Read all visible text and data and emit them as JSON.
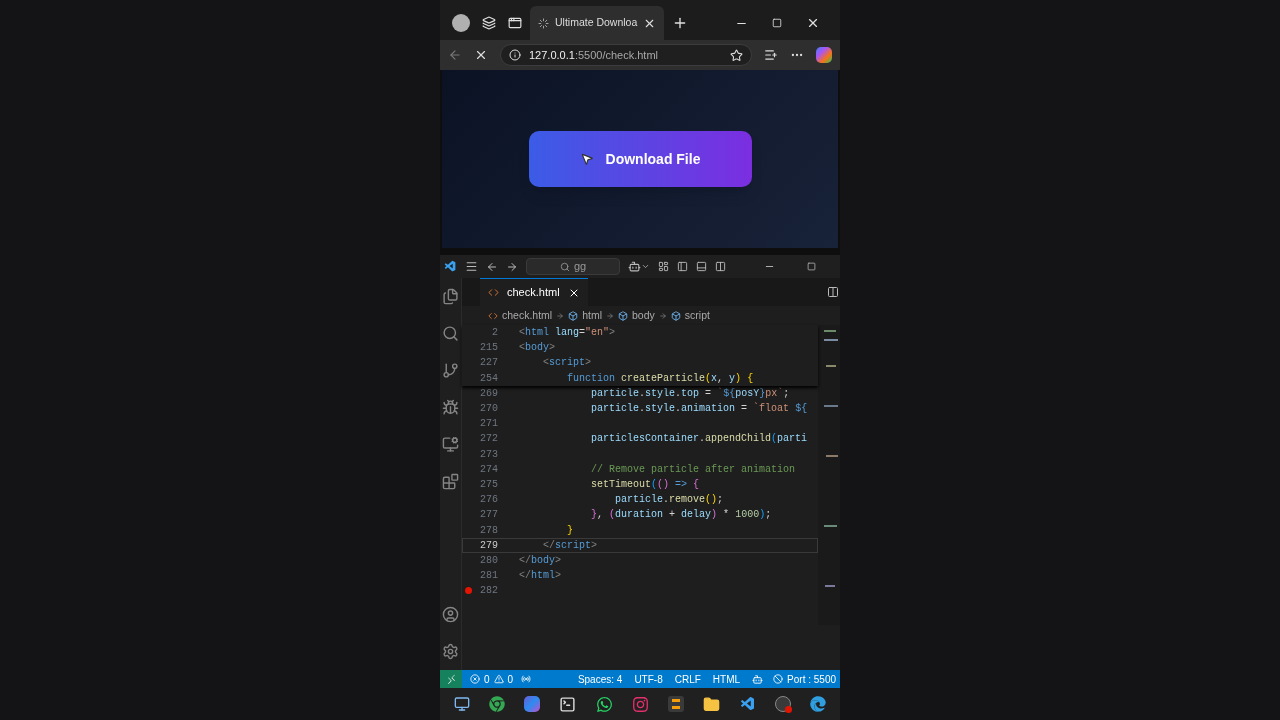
{
  "browser": {
    "tab": {
      "title": "Ultimate Downloa",
      "selected": true,
      "loading": true
    },
    "url_host": "127.0.0.1",
    "url_path": ":5500/check.html",
    "page_button": "Download File"
  },
  "editor": {
    "search": "gg",
    "tab": {
      "label": "check.html",
      "selected": true
    },
    "breadcrumbs": [
      "check.html",
      "html",
      "body",
      "script"
    ],
    "sticky_lines": [
      {
        "number": "2",
        "tokens": [
          {
            "text": "<",
            "kind": "punct"
          },
          {
            "text": "html",
            "kind": "tag"
          },
          {
            "text": " lang",
            "kind": "attr"
          },
          {
            "text": "=",
            "kind": "plain"
          },
          {
            "text": "\"en\"",
            "kind": "str"
          },
          {
            "text": ">",
            "kind": "punct"
          }
        ]
      },
      {
        "number": "215",
        "tokens": [
          {
            "text": "<",
            "kind": "punct"
          },
          {
            "text": "body",
            "kind": "tag"
          },
          {
            "text": ">",
            "kind": "punct"
          }
        ]
      },
      {
        "number": "227",
        "tokens": [
          {
            "text": "    <",
            "kind": "punct"
          },
          {
            "text": "script",
            "kind": "tag"
          },
          {
            "text": ">",
            "kind": "punct"
          }
        ]
      },
      {
        "number": "254",
        "tokens": [
          {
            "text": "        function ",
            "kind": "kw"
          },
          {
            "text": "createParticle",
            "kind": "fn"
          },
          {
            "text": "(",
            "kind": "br1"
          },
          {
            "text": "x",
            "kind": "var"
          },
          {
            "text": ", ",
            "kind": "plain"
          },
          {
            "text": "y",
            "kind": "var"
          },
          {
            "text": ")",
            "kind": "br1"
          },
          {
            "text": " {",
            "kind": "br1"
          }
        ]
      }
    ],
    "lines": [
      {
        "number": "269",
        "current": false,
        "breakpoint": false,
        "tokens": [
          {
            "text": "            particle",
            "kind": "var"
          },
          {
            "text": ".",
            "kind": "plain"
          },
          {
            "text": "style",
            "kind": "var"
          },
          {
            "text": ".",
            "kind": "plain"
          },
          {
            "text": "top",
            "kind": "var"
          },
          {
            "text": " = ",
            "kind": "plain"
          },
          {
            "text": "`",
            "kind": "str"
          },
          {
            "text": "${",
            "kind": "kw"
          },
          {
            "text": "posY",
            "kind": "var"
          },
          {
            "text": "}",
            "kind": "kw"
          },
          {
            "text": "px`",
            "kind": "str"
          },
          {
            "text": ";",
            "kind": "plain"
          }
        ]
      },
      {
        "number": "270",
        "current": false,
        "breakpoint": false,
        "tokens": [
          {
            "text": "            particle",
            "kind": "var"
          },
          {
            "text": ".",
            "kind": "plain"
          },
          {
            "text": "style",
            "kind": "var"
          },
          {
            "text": ".",
            "kind": "plain"
          },
          {
            "text": "animation",
            "kind": "var"
          },
          {
            "text": " = ",
            "kind": "plain"
          },
          {
            "text": "`float ",
            "kind": "str"
          },
          {
            "text": "${",
            "kind": "kw"
          }
        ]
      },
      {
        "number": "271",
        "current": false,
        "breakpoint": false
      },
      {
        "number": "272",
        "current": false,
        "breakpoint": false,
        "tokens": [
          {
            "text": "            particlesContainer",
            "kind": "var"
          },
          {
            "text": ".",
            "kind": "plain"
          },
          {
            "text": "appendChild",
            "kind": "fn"
          },
          {
            "text": "(",
            "kind": "br3"
          },
          {
            "text": "parti",
            "kind": "var"
          }
        ]
      },
      {
        "number": "273",
        "current": false,
        "breakpoint": false
      },
      {
        "number": "274",
        "current": false,
        "breakpoint": false,
        "tokens": [
          {
            "text": "            // Remove particle after animation",
            "kind": "comment"
          }
        ]
      },
      {
        "number": "275",
        "current": false,
        "breakpoint": false,
        "tokens": [
          {
            "text": "            setTimeout",
            "kind": "fn"
          },
          {
            "text": "(",
            "kind": "br3"
          },
          {
            "text": "()",
            "kind": "br2"
          },
          {
            "text": " =>",
            "kind": "kw"
          },
          {
            "text": " {",
            "kind": "br2"
          }
        ]
      },
      {
        "number": "276",
        "current": false,
        "breakpoint": false,
        "tokens": [
          {
            "text": "                particle",
            "kind": "var"
          },
          {
            "text": ".",
            "kind": "plain"
          },
          {
            "text": "remove",
            "kind": "fn"
          },
          {
            "text": "()",
            "kind": "br1"
          },
          {
            "text": ";",
            "kind": "plain"
          }
        ]
      },
      {
        "number": "277",
        "current": false,
        "breakpoint": false,
        "tokens": [
          {
            "text": "            }",
            "kind": "br2"
          },
          {
            "text": ", ",
            "kind": "plain"
          },
          {
            "text": "(",
            "kind": "br2"
          },
          {
            "text": "duration",
            "kind": "var"
          },
          {
            "text": " + ",
            "kind": "plain"
          },
          {
            "text": "delay",
            "kind": "var"
          },
          {
            "text": ")",
            "kind": "br2"
          },
          {
            "text": " * ",
            "kind": "plain"
          },
          {
            "text": "1000",
            "kind": "num"
          },
          {
            "text": ")",
            "kind": "br3"
          },
          {
            "text": ";",
            "kind": "plain"
          }
        ]
      },
      {
        "number": "278",
        "current": false,
        "breakpoint": false,
        "tokens": [
          {
            "text": "        }",
            "kind": "br1"
          }
        ]
      },
      {
        "number": "279",
        "current": true,
        "breakpoint": false,
        "tokens": [
          {
            "text": "    </",
            "kind": "punct"
          },
          {
            "text": "script",
            "kind": "tag"
          },
          {
            "text": ">",
            "kind": "punct"
          }
        ]
      },
      {
        "number": "280",
        "current": false,
        "breakpoint": false,
        "tokens": [
          {
            "text": "</",
            "kind": "punct"
          },
          {
            "text": "body",
            "kind": "tag"
          },
          {
            "text": ">",
            "kind": "punct"
          }
        ]
      },
      {
        "number": "281",
        "current": false,
        "breakpoint": false,
        "tokens": [
          {
            "text": "</",
            "kind": "punct"
          },
          {
            "text": "html",
            "kind": "tag"
          },
          {
            "text": ">",
            "kind": "punct"
          }
        ]
      },
      {
        "number": "282",
        "current": false,
        "breakpoint": true
      }
    ]
  },
  "status_bar": {
    "errors": "0",
    "warnings": "0",
    "items": [
      "Spaces: 4",
      "UTF-8",
      "CRLF",
      "HTML"
    ],
    "port": "Port : 5500"
  }
}
